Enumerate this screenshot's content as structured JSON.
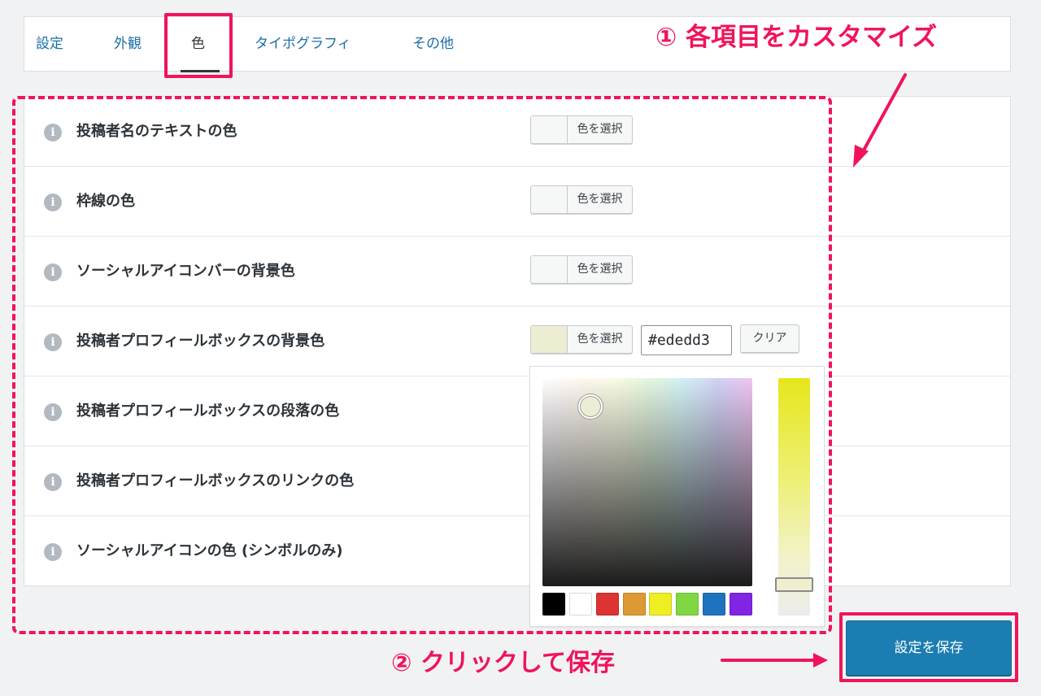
{
  "tabs": [
    {
      "label": "設定"
    },
    {
      "label": "外観"
    },
    {
      "label": "色"
    },
    {
      "label": "タイポグラフィ"
    },
    {
      "label": "その他"
    }
  ],
  "active_tab": "色",
  "rows": [
    {
      "label": "投稿者名のテキストの色"
    },
    {
      "label": "枠線の色"
    },
    {
      "label": "ソーシャルアイコンバーの背景色"
    },
    {
      "label": "投稿者プロフィールボックスの背景色"
    },
    {
      "label": "投稿者プロフィールボックスの段落の色"
    },
    {
      "label": "投稿者プロフィールボックスのリンクの色"
    },
    {
      "label": "ソーシャルアイコンの色 (シンボルのみ)"
    }
  ],
  "color_picker": {
    "select_label": "色を選択",
    "hex_value": "#ededd3",
    "clear_label": "クリア",
    "current_color": "#ededd3",
    "palette": [
      "#000000",
      "#ffffff",
      "#dd3333",
      "#dd9933",
      "#eeee22",
      "#81d742",
      "#1e73be",
      "#8224e3"
    ]
  },
  "info_icon_glyph": "i",
  "annotations": {
    "step1": "① 各項目をカスタマイズ",
    "step2": "② クリックして保存"
  },
  "save_button": {
    "label": "設定を保存"
  },
  "colors": {
    "accent": "#f0145a",
    "primary_button": "#1c7db2",
    "link": "#1a6fa6"
  }
}
